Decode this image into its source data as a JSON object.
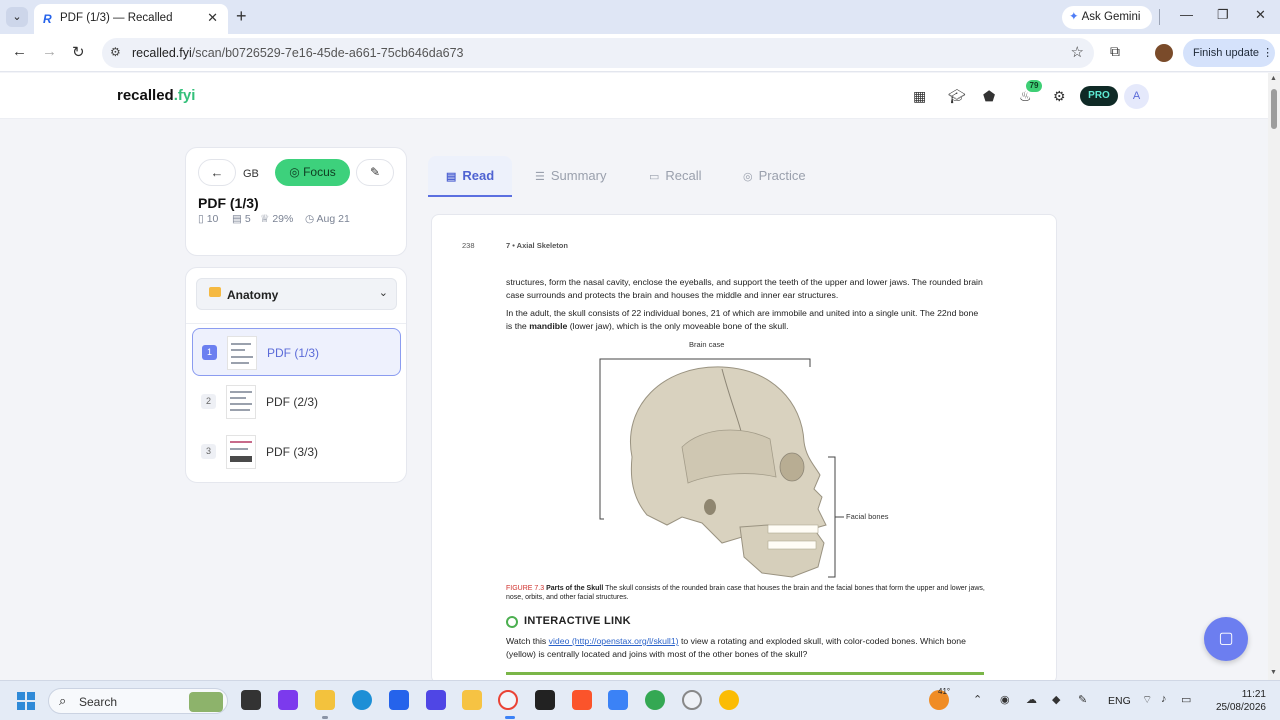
{
  "browser": {
    "tab_title": "PDF (1/3) — Recalled",
    "tab_favicon": "R",
    "url_host": "recalled.fyi",
    "url_path": "/scan/b0726529-7e16-45de-a661-75cb646da673",
    "ask_gemini": "Ask Gemini",
    "finish_update": "Finish update"
  },
  "app": {
    "logo_main": "recalled",
    "logo_suffix": ".fyi",
    "streak_badge": "79",
    "pro_label": "PRO",
    "avatar_initial": "A"
  },
  "sidebar": {
    "gb": "GB",
    "focus_label": "Focus",
    "doc_title": "PDF (1/3)",
    "meta": {
      "pages": "10",
      "cards": "5",
      "progress": "29%",
      "date": "Aug 21"
    },
    "folder": "Anatomy",
    "items": [
      {
        "num": "1",
        "label": "PDF (1/3)"
      },
      {
        "num": "2",
        "label": "PDF (2/3)"
      },
      {
        "num": "3",
        "label": "PDF (3/3)"
      }
    ]
  },
  "tabs": [
    {
      "label": "Read",
      "icon": "book-icon"
    },
    {
      "label": "Summary",
      "icon": "list-icon"
    },
    {
      "label": "Recall",
      "icon": "cards-icon"
    },
    {
      "label": "Practice",
      "icon": "target-icon"
    }
  ],
  "doc": {
    "page_number": "238",
    "running_head": "7 • Axial Skeleton",
    "para1": "structures, form the nasal cavity, enclose the eyeballs, and support the teeth of the upper and lower jaws. The rounded brain case surrounds and protects the brain and houses the middle and inner ear structures.",
    "para2_a": "In the adult, the skull consists of 22 individual bones, 21 of which are immobile and united into a single unit. The 22nd bone is the ",
    "para2_bold": "mandible",
    "para2_b": " (lower jaw), which is the only moveable bone of the skull.",
    "label_brain_case": "Brain case",
    "label_facial_bones": "Facial bones",
    "caption_fig": "FIGURE 7.3",
    "caption_title": "Parts of the Skull",
    "caption_text": " The skull consists of the rounded brain case that houses the brain and the facial bones that form the upper and lower jaws, nose, orbits, and other facial structures.",
    "interactive_heading": "INTERACTIVE LINK",
    "link_pre": "Watch this ",
    "link_text": "video (http://openstax.org/l/skull1)",
    "link_post": " to view a rotating and exploded skull, with color-coded bones. Which bone (yellow) is centrally located and joins with most of the other bones of the skull?"
  },
  "taskbar": {
    "search_label": "Search",
    "temperature": "41°",
    "language": "ENG",
    "time": "11:21",
    "date": "25/08/2026"
  },
  "colors": {
    "accent": "#5b6fe0",
    "focus_green": "#3dd17c",
    "brand_green": "#34c07a"
  }
}
